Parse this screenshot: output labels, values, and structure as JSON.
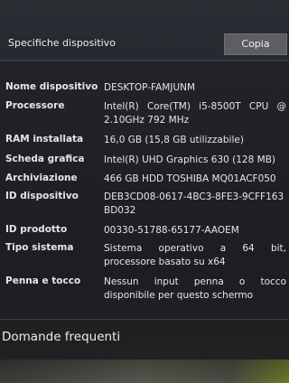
{
  "header": {
    "title": "Specifiche dispositivo",
    "copy_label": "Copia"
  },
  "specs": [
    {
      "label": "Nome dispositivo",
      "value": "DESKTOP-FAMJUNM"
    },
    {
      "label": "Processore",
      "value": "Intel(R) Core(TM) i5-8500T CPU @ 2.10GHz 792 MHz"
    },
    {
      "label": "RAM installata",
      "value": "16,0 GB (15,8 GB utilizzabile)"
    },
    {
      "label": "Scheda grafica",
      "value": "Intel(R) UHD Graphics 630 (128 MB)"
    },
    {
      "label": "Archiviazione",
      "value": "466 GB HDD TOSHIBA MQ01ACF050"
    },
    {
      "label": "ID dispositivo",
      "value": "DEB3CD08-0617-4BC3-8FE3-9CFF163BD032"
    },
    {
      "label": "ID prodotto",
      "value": "00330-51788-65177-AAOEM"
    },
    {
      "label": "Tipo sistema",
      "value": "Sistema operativo a 64 bit, processore basato su x64"
    },
    {
      "label": "Penna e tocco",
      "value": "Nessun input penna o tocco disponibile per questo schermo"
    }
  ],
  "faq": {
    "label": "Domande frequenti"
  }
}
